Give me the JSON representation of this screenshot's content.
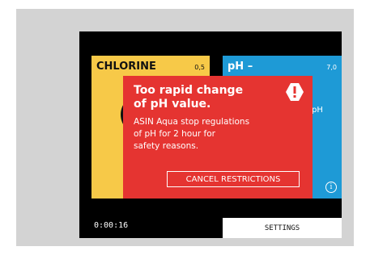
{
  "panels": {
    "chlorine": {
      "title": "CHLORINE",
      "value": "0,5"
    },
    "ph": {
      "title": "pH –",
      "value": "7,0",
      "unit": "pH",
      "info_icon": "i"
    }
  },
  "alert": {
    "title": "Too rapid change\nof pH value.",
    "body": "ASIN Aqua stop regulations\nof pH for 2 hour for\nsafety reasons.",
    "cancel_label": "CANCEL RESTRICTIONS",
    "icon": "warning-hexagon-icon"
  },
  "timer": "0:00:16",
  "settings_label": "SETTINGS",
  "colors": {
    "frame": "#d3d3d3",
    "screen": "#000000",
    "chlorine": "#f7c948",
    "ph": "#1e9ad6",
    "alert": "#e53431"
  }
}
